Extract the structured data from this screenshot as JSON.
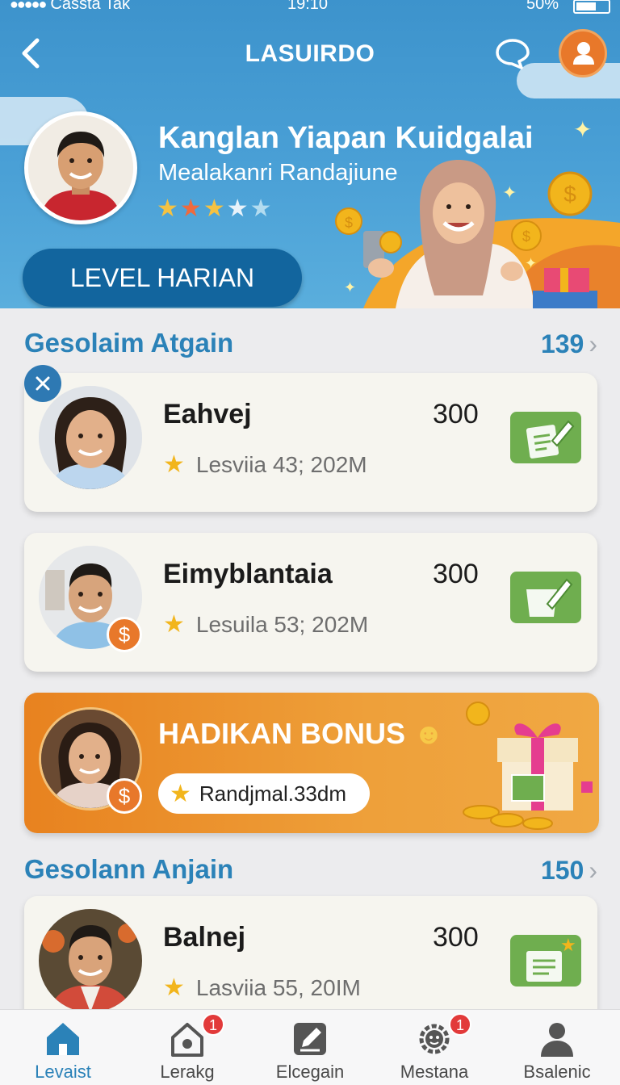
{
  "status_bar": {
    "carrier": "Cassta Tak",
    "time": "19:10",
    "battery": "50%"
  },
  "header": {
    "title": "LASUIRDO"
  },
  "profile": {
    "name": "Kanglan Yiapan Kuidgalai",
    "subtitle": "Mealakanri Randajiune",
    "rating": 3,
    "rating_max": 5,
    "level_button": "LEVEL HARIAN"
  },
  "sections": [
    {
      "title": "Gesolaim Atgain",
      "count": "139",
      "items": [
        {
          "name": "Eahvej",
          "value": "300",
          "meta": "Lesviia 43; 202M"
        },
        {
          "name": "Eimyblantaia",
          "value": "300",
          "meta": "Lesuila 53; 202M"
        }
      ]
    },
    {
      "title": "Gesolann Anjain",
      "count": "150",
      "items": [
        {
          "name": "Balnej",
          "value": "300",
          "meta": "Lasviia 55, 20IM"
        }
      ]
    }
  ],
  "bonus": {
    "title": "HADIKAN BONUS",
    "pill": "Randjmal.33dm"
  },
  "nav": [
    {
      "label": "Levaist",
      "icon": "home-icon",
      "active": true,
      "badge": ""
    },
    {
      "label": "Lerakg",
      "icon": "house-gear-icon",
      "active": false,
      "badge": "1"
    },
    {
      "label": "Elcegain",
      "icon": "edit-icon",
      "active": false,
      "badge": ""
    },
    {
      "label": "Mestana",
      "icon": "gear-face-icon",
      "active": false,
      "badge": "1"
    },
    {
      "label": "Bsalenic",
      "icon": "user-icon",
      "active": false,
      "badge": ""
    }
  ],
  "colors": {
    "primary": "#2b82b8",
    "header": "#4aa0d6",
    "accent": "#e8782a",
    "action": "#6fae4f"
  }
}
